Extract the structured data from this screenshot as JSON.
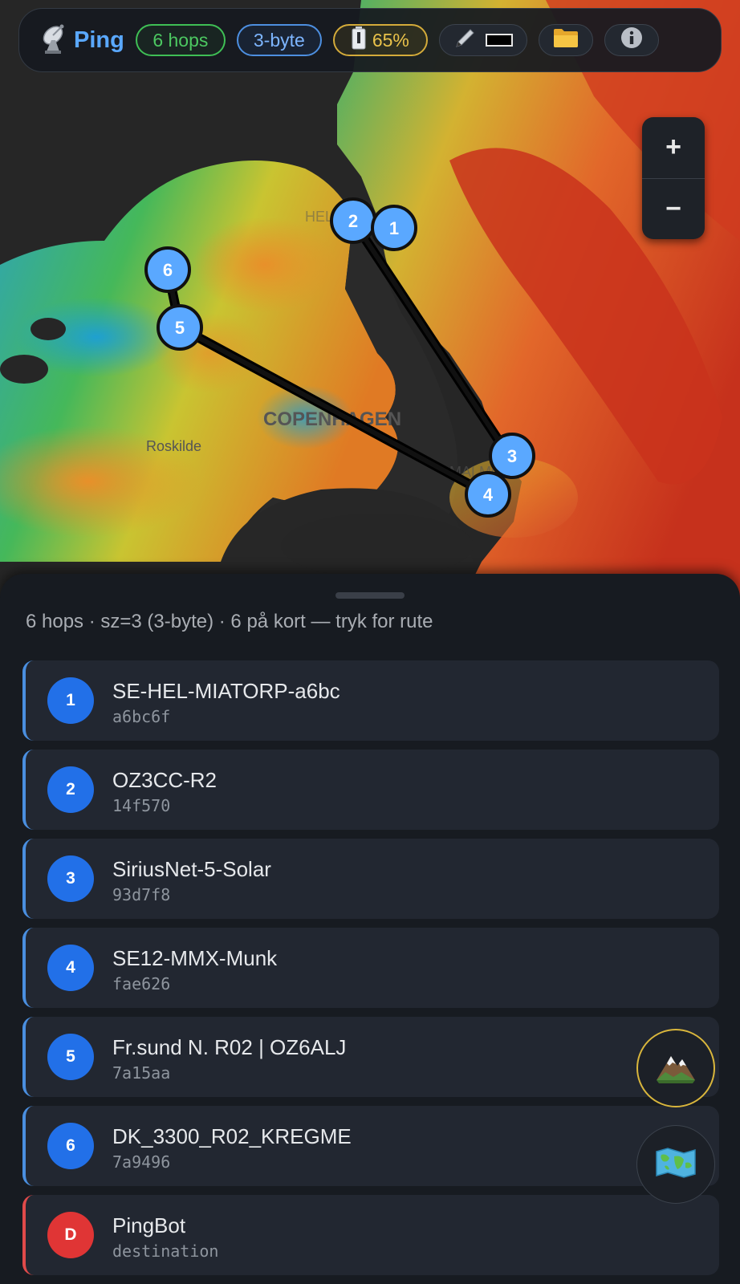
{
  "header": {
    "icon": "satellite-dish-icon",
    "title": "Ping",
    "hops_badge": "6 hops",
    "size_badge": "3-byte",
    "battery_icon": "battery-icon",
    "battery_badge": "65%",
    "pen_icon": "pen-icon",
    "folder_icon": "folder-icon",
    "info_icon": "info-icon"
  },
  "map": {
    "zoom_in_label": "+",
    "zoom_out_label": "−",
    "place_labels": [
      "COPENHAGEN",
      "Roskilde",
      "HELSINGBORG",
      "MALMÖ"
    ],
    "markers": [
      "1",
      "2",
      "3",
      "4",
      "5",
      "6"
    ]
  },
  "sheet": {
    "summary": "6 hops · sz=3 (3-byte) · 6 på kort — tryk for rute",
    "hops": [
      {
        "n": "1",
        "name": "SE-HEL-MIATORP-a6bc",
        "id": "a6bc6f"
      },
      {
        "n": "2",
        "name": "OZ3CC-R2",
        "id": "14f570"
      },
      {
        "n": "3",
        "name": "SiriusNet-5-Solar",
        "id": "93d7f8"
      },
      {
        "n": "4",
        "name": "SE12-MMX-Munk",
        "id": "fae626"
      },
      {
        "n": "5",
        "name": "Fr.sund N. R02 | OZ6ALJ",
        "id": "7a15aa"
      },
      {
        "n": "6",
        "name": "DK_3300_R02_KREGME",
        "id": "7a9496"
      },
      {
        "n": "D",
        "name": "PingBot",
        "id": "destination"
      }
    ]
  },
  "fabs": {
    "terrain_icon": "mountain-icon",
    "map_icon": "world-map-icon"
  },
  "colors": {
    "accent": "#5aa8ff",
    "hop_badge": "#2270e8",
    "destination": "#e03535",
    "green": "#3fbf55",
    "yellow": "#d4ab3a"
  }
}
